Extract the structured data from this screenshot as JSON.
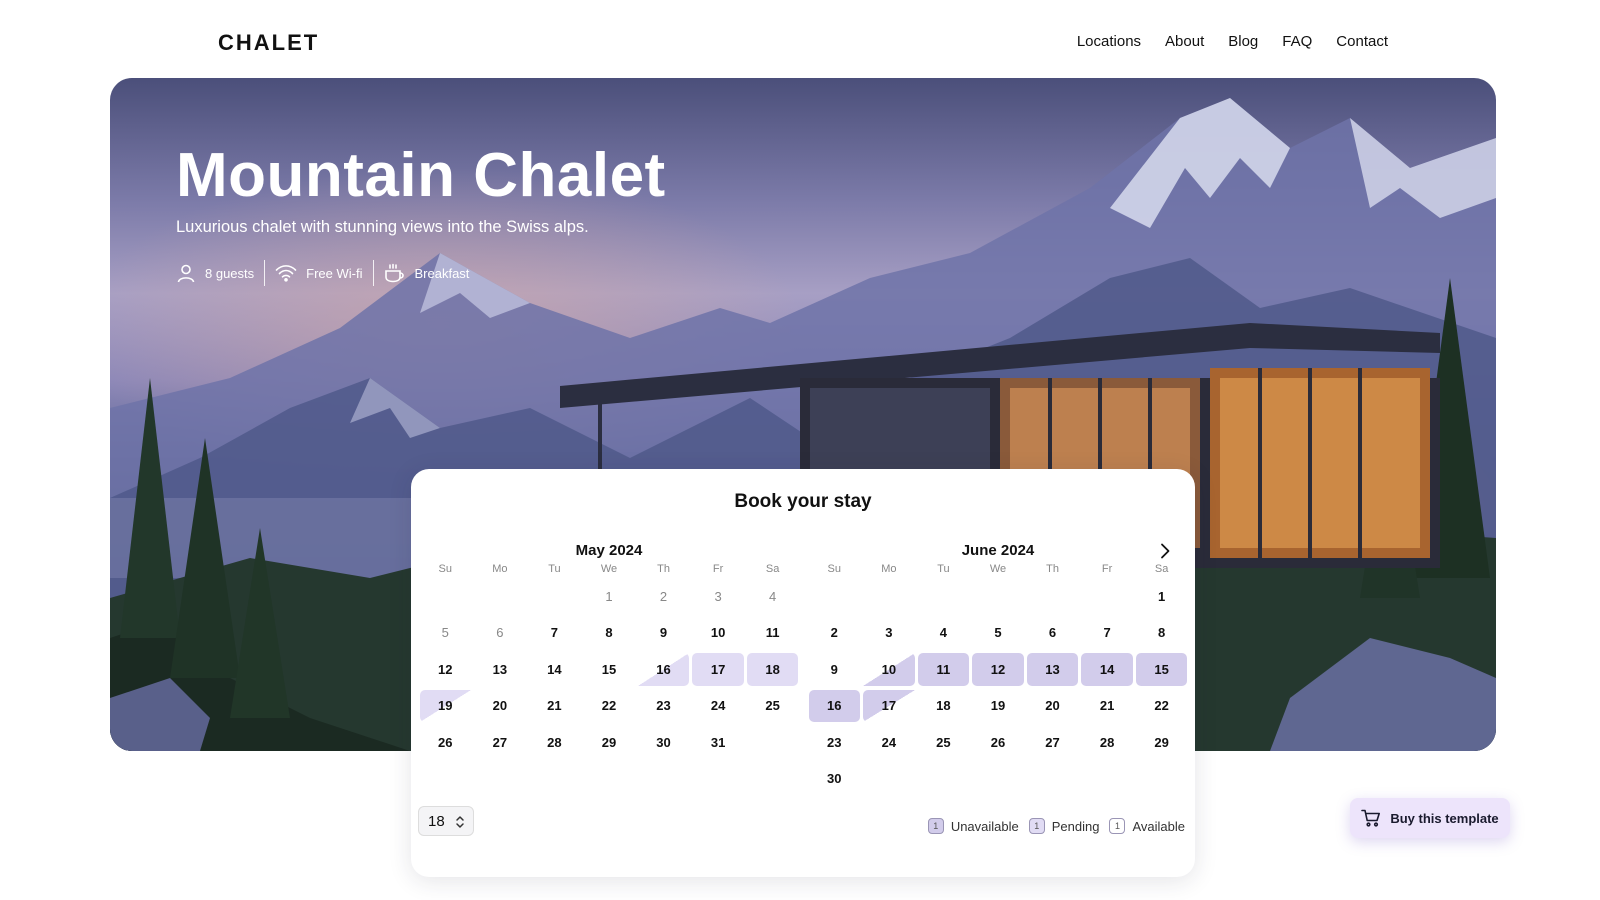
{
  "header": {
    "logo": "CHALET",
    "nav": [
      "Locations",
      "About",
      "Blog",
      "FAQ",
      "Contact"
    ]
  },
  "hero": {
    "title": "Mountain Chalet",
    "subtitle": "Luxurious chalet with stunning views into the Swiss alps.",
    "amenities": [
      {
        "icon": "user-icon",
        "label": "8 guests"
      },
      {
        "icon": "wifi-icon",
        "label": "Free Wi-fi"
      },
      {
        "icon": "coffee-cup-icon",
        "label": "Breakfast"
      }
    ]
  },
  "booking": {
    "title": "Book your stay",
    "weekdays": [
      "Su",
      "Mo",
      "Tu",
      "We",
      "Th",
      "Fr",
      "Sa"
    ],
    "may": {
      "title": "May 2024",
      "leading_blanks": 3,
      "days": [
        "1",
        "2",
        "3",
        "4",
        "5",
        "6",
        "7",
        "8",
        "9",
        "10",
        "11",
        "12",
        "13",
        "14",
        "15",
        "16",
        "17",
        "18",
        "19",
        "20",
        "21",
        "22",
        "23",
        "24",
        "25",
        "26",
        "27",
        "28",
        "29",
        "30",
        "31"
      ],
      "past_days": [
        "1",
        "2",
        "3",
        "4",
        "5",
        "6"
      ],
      "pending": [
        "16",
        "17",
        "18",
        "19"
      ],
      "unavailable": []
    },
    "june": {
      "title": "June 2024",
      "leading_blanks": 6,
      "days": [
        "1",
        "2",
        "3",
        "4",
        "5",
        "6",
        "7",
        "8",
        "9",
        "10",
        "11",
        "12",
        "13",
        "14",
        "15",
        "16",
        "17",
        "18",
        "19",
        "20",
        "21",
        "22",
        "23",
        "24",
        "25",
        "26",
        "27",
        "28",
        "29",
        "30"
      ],
      "past_days": [],
      "pending": [],
      "unavailable": [
        "10",
        "11",
        "12",
        "13",
        "14",
        "15",
        "16",
        "17"
      ]
    },
    "stepper_value": "18",
    "legend": {
      "swatch_text": "1",
      "unavailable": "Unavailable",
      "pending": "Pending",
      "available": "Available"
    }
  },
  "buy_button": "Buy this template",
  "colors": {
    "pending": "#e1dcf4",
    "unavailable": "#d2cceb",
    "buy_button_bg": "#ede4fb"
  }
}
